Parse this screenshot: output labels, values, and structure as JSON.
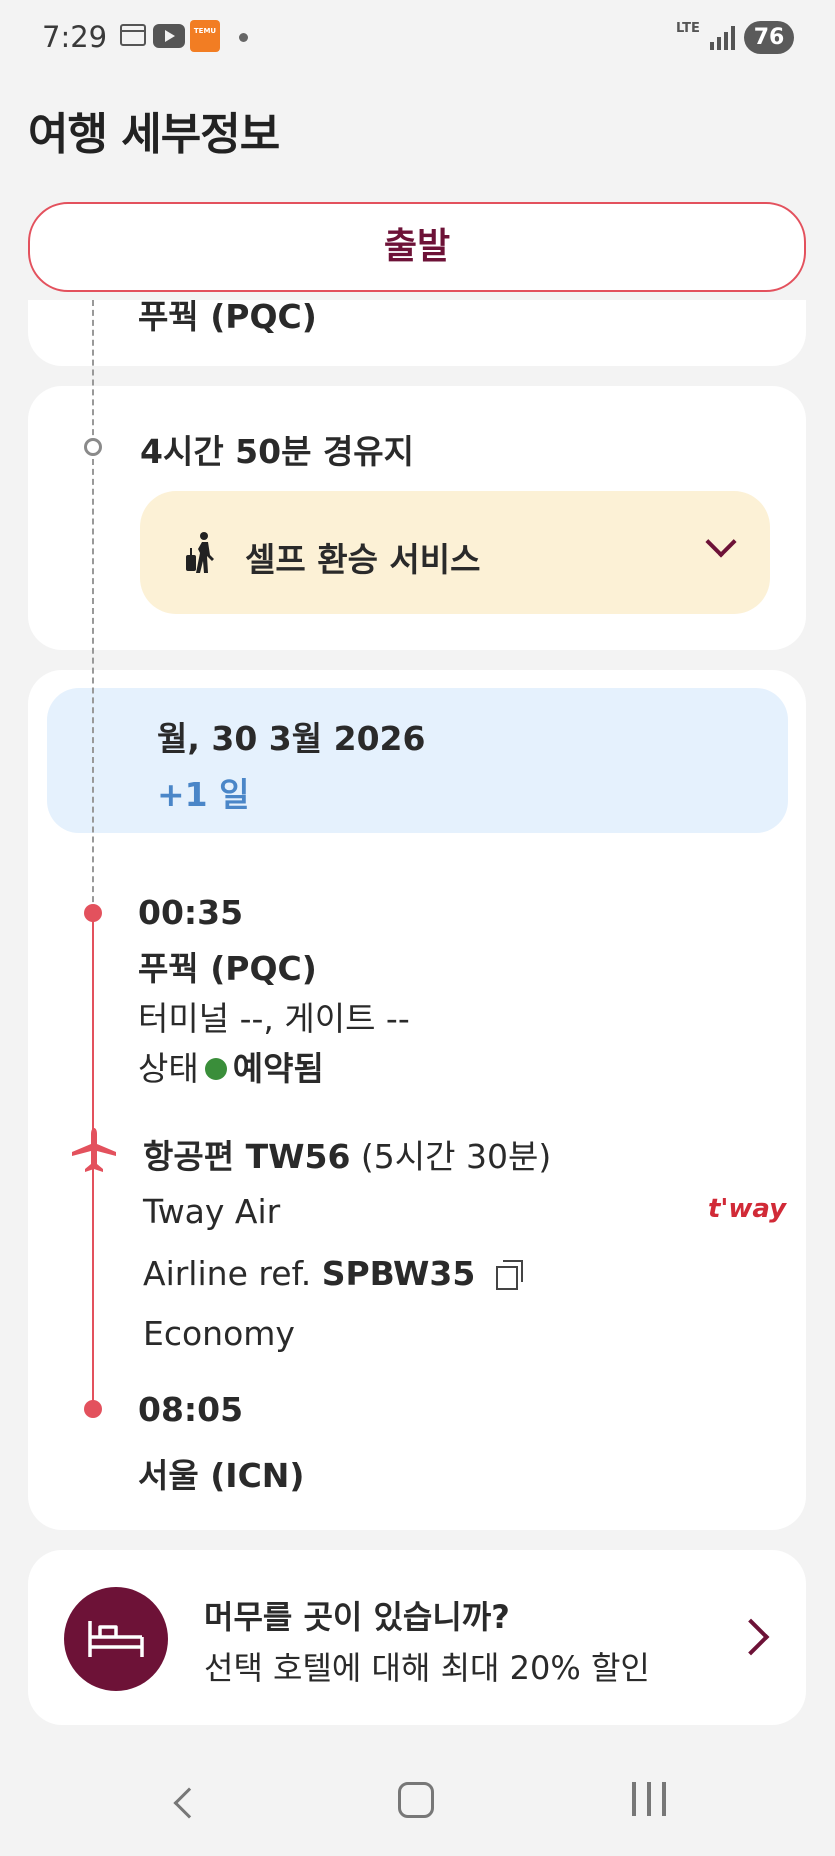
{
  "status_bar": {
    "time": "7:29",
    "temu_label": "TEMU",
    "network": "LTE",
    "battery": "76",
    "icons": [
      "calendar-icon",
      "youtube-icon",
      "temu-icon",
      "notification-dot",
      "lte-icon",
      "signal-icon",
      "battery-icon"
    ]
  },
  "header": {
    "title": "여행 세부정보"
  },
  "departure_button": {
    "label": "출발"
  },
  "previous_stop": {
    "airport": "푸꿕 (PQC)"
  },
  "layover": {
    "duration": "4시간 50분 경유지",
    "transfer_label": "셀프 환승 서비스",
    "transfer_icon": "traveler-luggage-icon"
  },
  "segment": {
    "date": "월, 30 3월 2026",
    "day_offset": "+1 일",
    "departure": {
      "time": "00:35",
      "airport": "푸꿕 (PQC)",
      "terminal_gate": "터미널 --, 게이트 --",
      "status_prefix": "상태",
      "status": "예약됨",
      "status_color": "#3a8e3a"
    },
    "flight": {
      "number": "항공편 TW56",
      "duration": "(5시간 30분)",
      "airline": "Tway Air",
      "airline_logo": "t'way",
      "ref_prefix": "Airline ref.",
      "ref_code": "SPBW35",
      "cabin": "Economy"
    },
    "arrival": {
      "time": "08:05",
      "airport": "서울 (ICN)"
    }
  },
  "hotel_promo": {
    "title": "머무를 곳이 있습니까?",
    "subtitle": "선택 호텔에 대해 최대 20% 할인",
    "icon": "bed-icon"
  },
  "colors": {
    "accent": "#6d1237",
    "route_red": "#e3515d",
    "date_bg": "#e5f1fd",
    "transfer_bg": "#fcf1d6",
    "day_offset_blue": "#4a86c8"
  },
  "navbar": {
    "buttons": [
      "back-button",
      "home-button",
      "recents-button"
    ]
  }
}
